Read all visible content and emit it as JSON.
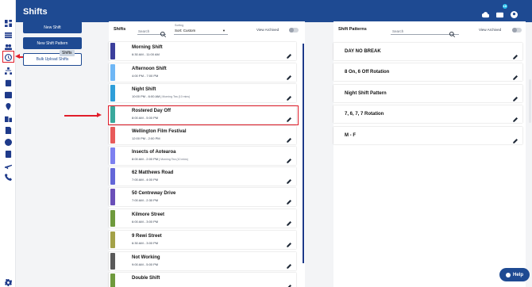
{
  "header": {
    "title": "Shifts",
    "notification_count": "10"
  },
  "actions": {
    "new_shift": "New Shift",
    "new_shift_pattern": "New Shift Pattern",
    "bulk_upload": "Bulk Upload Shifts",
    "tooltip": "Shifts"
  },
  "shifts_panel": {
    "title": "Shifts",
    "search_placeholder": "Search",
    "sort_caption": "Sorting",
    "sort_value": "Sort: Custom",
    "view_archived": "View Archived",
    "items": [
      {
        "name": "Morning Shift",
        "time": "6:30 AM - 11:00 AM",
        "break": "",
        "color": "#3b3f9c"
      },
      {
        "name": "Afternoon Shift",
        "time": "4:00 PM - 7:00 PM",
        "break": "",
        "color": "#6fb7f5"
      },
      {
        "name": "Night Shift",
        "time": "10:00 PM - 6:00 AM",
        "break": "Morning Tea (10 mins)",
        "color": "#2f9ed9"
      },
      {
        "name": "Rostered Day Off",
        "time": "8:00 AM - 5:00 PM",
        "break": "",
        "color": "#3aa89c"
      },
      {
        "name": "Wellington Film Festival",
        "time": "12:00 PM - 2:00 PM",
        "break": "",
        "color": "#e85a5a"
      },
      {
        "name": "Insects of Aotearoa",
        "time": "8:00 AM - 2:00 PM",
        "break": "Morning Tea (10 mins)",
        "color": "#7d80f0"
      },
      {
        "name": "62 Matthews Road",
        "time": "7:00 AM - 4:00 PM",
        "break": "",
        "color": "#6366d8"
      },
      {
        "name": "50 Centreway Drive",
        "time": "7:00 AM - 2:30 PM",
        "break": "",
        "color": "#6a4fb8"
      },
      {
        "name": "Kilmore Street",
        "time": "6:00 AM - 3:00 PM",
        "break": "",
        "color": "#6f9a3d"
      },
      {
        "name": "9 Rewi Street",
        "time": "6:30 AM - 3:00 PM",
        "break": "",
        "color": "#a3a148"
      },
      {
        "name": "Not Working",
        "time": "9:00 AM - 5:00 PM",
        "break": "",
        "color": "#5a5a5a"
      },
      {
        "name": "Double Shift",
        "time": "",
        "break": "",
        "color": "#6f9a3d"
      }
    ]
  },
  "patterns_panel": {
    "title": "Shift Patterns",
    "search_placeholder": "Search",
    "view_archived": "View Archived",
    "items": [
      {
        "name": "DAY NO BREAK"
      },
      {
        "name": "8 On, 6 Off Rotation"
      },
      {
        "name": "Night Shift Pattern"
      },
      {
        "name": "7, 6, 7, 7 Rotation"
      },
      {
        "name": "M - F"
      }
    ]
  },
  "help": {
    "label": "Help"
  },
  "sidebar": {
    "icons": [
      "dashboard-icon",
      "list-icon",
      "people-icon",
      "clock-icon",
      "org-chart-icon",
      "clipboard-icon",
      "calendar-icon",
      "location-icon",
      "building-icon",
      "document-icon",
      "dollar-icon",
      "reports-icon",
      "plane-icon",
      "phone-icon",
      "settings-icon"
    ]
  },
  "colors": {
    "brand": "#1e4a92",
    "highlight": "#e11d2a"
  }
}
